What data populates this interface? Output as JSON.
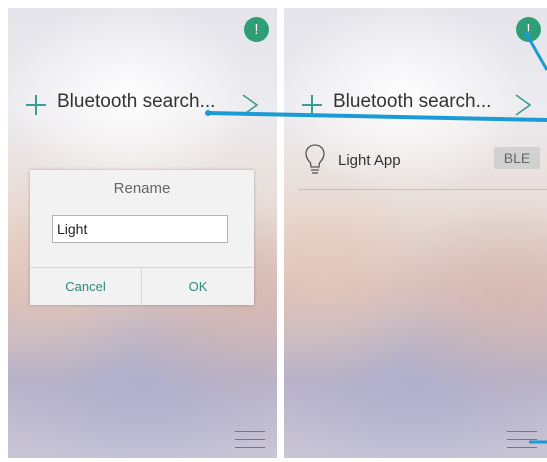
{
  "colors": {
    "accent": "#2f9e77",
    "plus": "#3a9d8f",
    "arrow": "#1a9ad6",
    "dialog_bg": "#f3f2f2"
  },
  "left_screen": {
    "alert_symbol": "!",
    "search_label": "Bluetooth search...",
    "dialog": {
      "title": "Rename",
      "input_value": "Light",
      "cancel_label": "Cancel",
      "ok_label": "OK"
    }
  },
  "right_screen": {
    "alert_symbol": "!",
    "search_label": "Bluetooth search...",
    "device": {
      "name": "Light App",
      "badge": "BLE",
      "icon": "light-bulb-icon"
    }
  },
  "icons": [
    "alert-icon",
    "plus-icon",
    "chevron-right-icon",
    "light-bulb-icon",
    "menu-icon"
  ]
}
